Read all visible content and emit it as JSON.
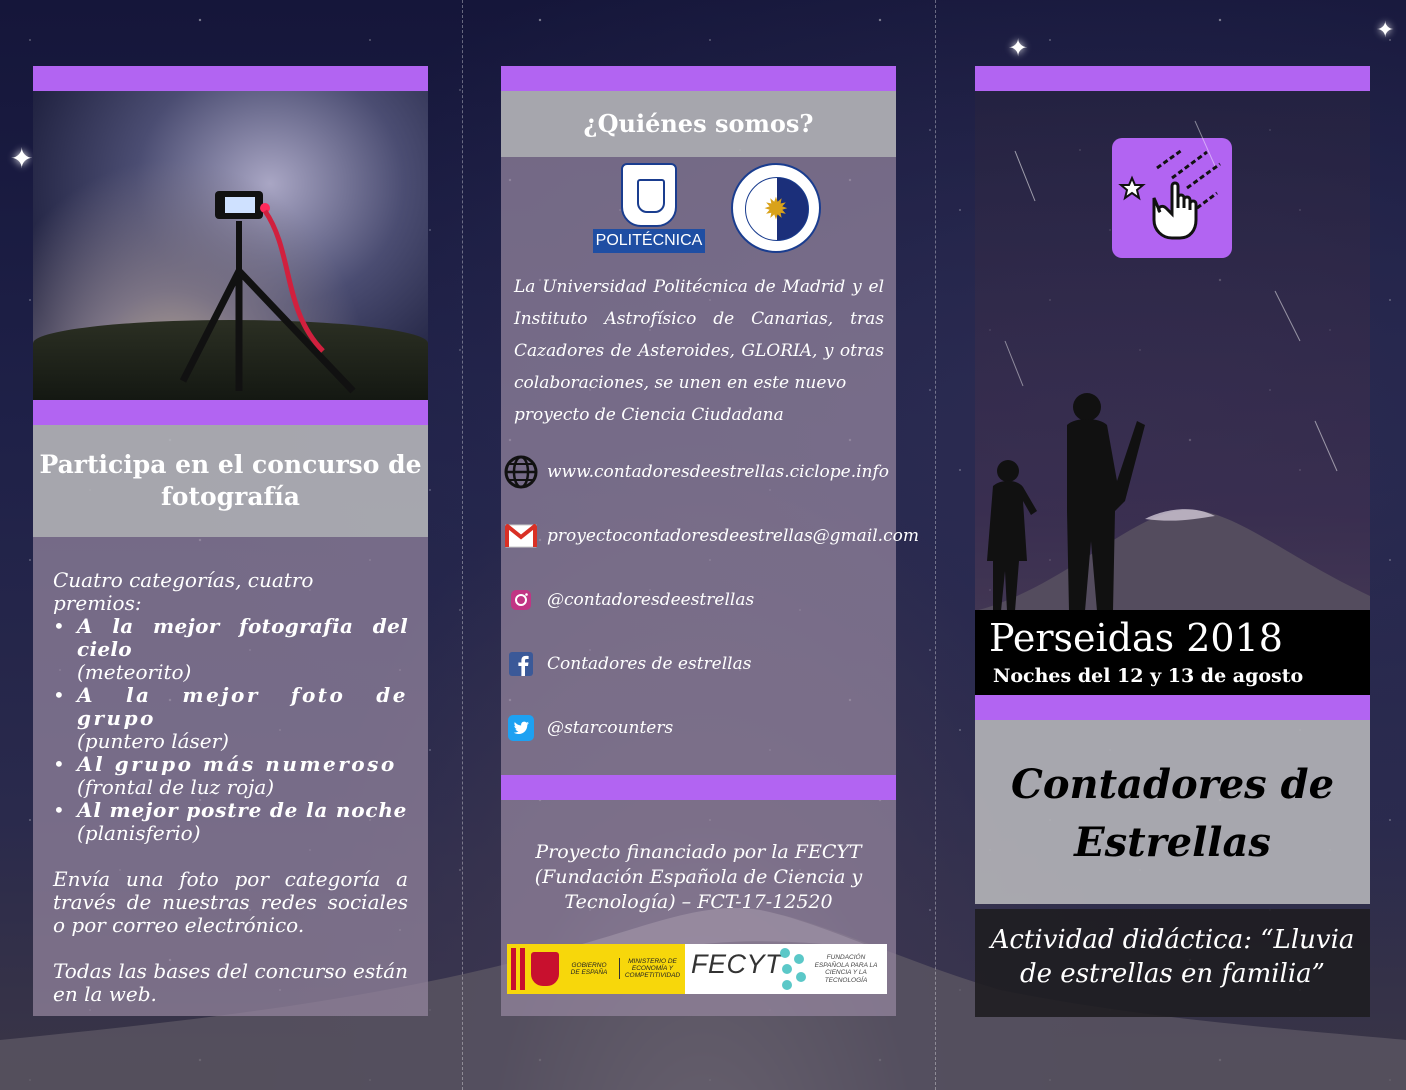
{
  "left_panel": {
    "heading": "Participa en el concurso de fotografía",
    "intro": "Cuatro categorías, cuatro premios:",
    "prizes": [
      {
        "title": "A la mejor fotografia del cielo",
        "prize": "(meteorito)"
      },
      {
        "title": "A la mejor foto de grupo",
        "prize": "(puntero láser)"
      },
      {
        "title": "Al grupo más numeroso",
        "prize": "(frontal de luz roja)"
      },
      {
        "title": "Al mejor postre de la noche",
        "prize": "(planisferio)"
      }
    ],
    "send": "Envía una foto por categoría a través de nuestras redes sociales o por correo electrónico.",
    "rules": "Todas las bases del concurso están en la web."
  },
  "middle_panel": {
    "heading": "¿Quiénes somos?",
    "upm_label": "POLITÉCNICA",
    "about": "La Universidad Politécnica de Madrid y el Instituto Astrofísico de Canarias, tras Cazadores de Asteroides, GLORIA, y otras colaboraciones, se unen en este nuevo",
    "about_last": "proyecto de Ciencia Ciudadana",
    "contacts": [
      {
        "icon": "globe-icon",
        "text": "www.contadoresdeestrellas.ciclope.info"
      },
      {
        "icon": "gmail-icon",
        "text": "proyectocontadoresdeestrellas@gmail.com"
      },
      {
        "icon": "instagram-icon",
        "text": "@contadoresdeestrellas"
      },
      {
        "icon": "facebook-icon",
        "text": "Contadores de estrellas"
      },
      {
        "icon": "twitter-icon",
        "text": "@starcounters"
      }
    ],
    "funding": "Proyecto financiado por la FECYT (Fundación Española de Ciencia y Tecnología) – FCT-17-12520",
    "gov_text": "GOBIERNO DE ESPAÑA",
    "ministry_text": "MINISTERIO DE ECONOMÍA Y COMPETITIVIDAD",
    "fecyt_word": "FECYT",
    "fecyt_sub": "FUNDACIÓN ESPAÑOLA PARA LA CIENCIA Y LA TECNOLOGÍA"
  },
  "right_panel": {
    "event": "Perseidas 2018",
    "dates": "Noches del 12 y 13 de agosto",
    "title_line1": "Contadores de",
    "title_line2": "Estrellas",
    "activity": "Actividad didáctica: “Lluvia de estrellas en familia”"
  },
  "colors": {
    "accent_purple": "#b264f2",
    "header_grey": "#b2b2b6",
    "panel_mauve": "#96879f"
  }
}
